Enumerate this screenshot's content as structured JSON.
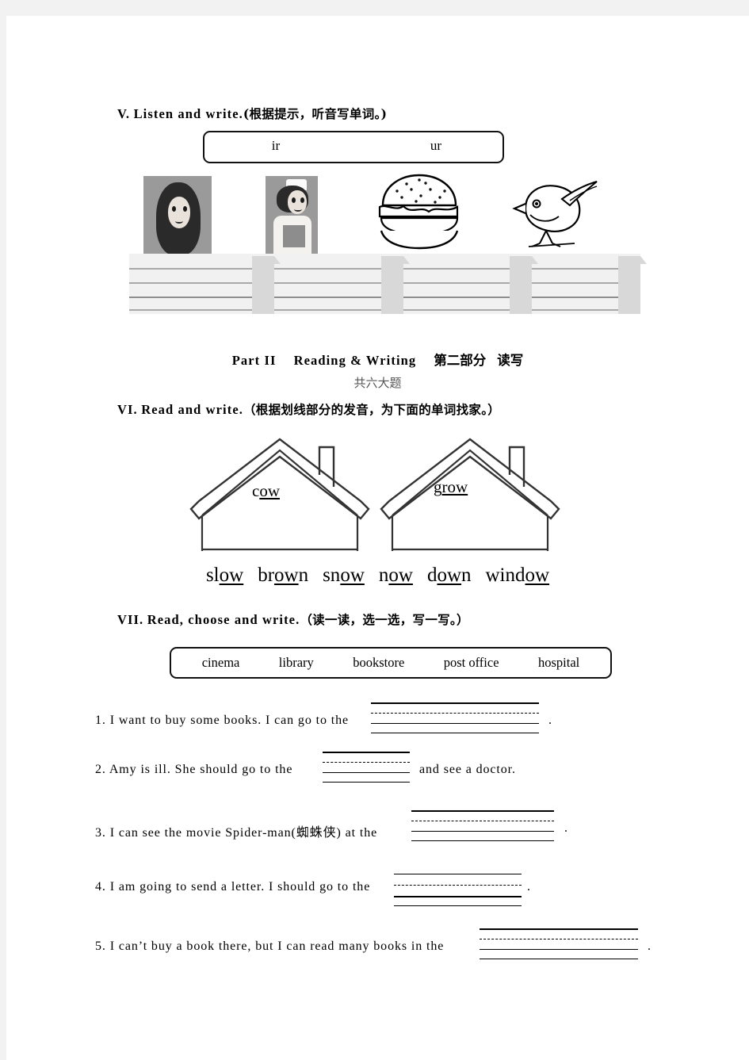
{
  "sections": {
    "listen_and_write": {
      "number": "V.",
      "title": "Listen  and  write.",
      "instruction_cn": "(根据提示，听音写单词。)",
      "phonics_box": [
        "ir",
        "ur"
      ],
      "picture_prompts": [
        "girl",
        "nurse",
        "hamburger",
        "bird"
      ]
    },
    "part_two": {
      "label_en": "Part II",
      "title_en": "Reading & Writing",
      "label_cn": "第二部分",
      "title_cn": "读写",
      "subcount_cn": "共六大题"
    },
    "read_and_write": {
      "number": "VI.",
      "title": "Read  and  write.",
      "instruction_cn": "（根据划线部分的发音，为下面的单词找家。）",
      "houses": [
        {
          "word": "cow",
          "prefix": "c",
          "underlined": "ow",
          "suffix": ""
        },
        {
          "word": "grow",
          "prefix": "g",
          "underlined": "row",
          "suffix": ""
        }
      ],
      "words": [
        {
          "prefix": "sl",
          "underlined": "ow",
          "suffix": ""
        },
        {
          "prefix": "br",
          "underlined": "ow",
          "suffix": "n"
        },
        {
          "prefix": "sn",
          "underlined": "ow",
          "suffix": ""
        },
        {
          "prefix": "n",
          "underlined": "ow",
          "suffix": ""
        },
        {
          "prefix": "d",
          "underlined": "ow",
          "suffix": "n"
        },
        {
          "prefix": "wind",
          "underlined": "ow",
          "suffix": ""
        }
      ]
    },
    "read_choose_write": {
      "number": "VII.",
      "title": "Read, choose and write.",
      "instruction_cn": "（读一读，选一选，写一写。）",
      "word_bank": [
        "cinema",
        "library",
        "bookstore",
        "post office",
        "hospital"
      ],
      "questions": [
        {
          "number": "1.",
          "text_before": "I  want  to  buy  some  books.  I  can  go  to  the",
          "text_after": ".",
          "cn_note": ""
        },
        {
          "number": "2.",
          "text_before": "Amy  is  ill.  She  should  go  to  the",
          "text_after": "and  see  a  doctor.",
          "cn_note": ""
        },
        {
          "number": "3.",
          "text_before": "I  can  see  the  movie  Spider-man(蜘蛛侠)  at  the",
          "text_after": ".",
          "cn_note": "蜘蛛侠"
        },
        {
          "number": "4.",
          "text_before": "I  am  going  to  send  a  letter.  I  should  go  to  the",
          "text_after": ".",
          "cn_note": ""
        },
        {
          "number": "5.",
          "text_before": "I  can’t  buy  a  book  there,  but  I  can  read  many  books  in  the",
          "text_after": ".",
          "cn_note": ""
        }
      ]
    }
  },
  "colors": {
    "page_background": "#f2f2f2",
    "paper": "#ffffff",
    "ink": "#000000",
    "staff_line": "#a8a8a8",
    "staff_fill": "#f1f1f1",
    "divider": "#d8d8d8"
  }
}
